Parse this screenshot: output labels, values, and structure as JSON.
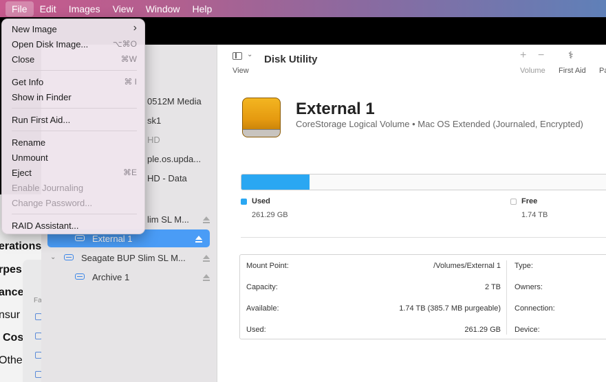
{
  "menubar": {
    "items": [
      "File",
      "Edit",
      "Images",
      "View",
      "Window",
      "Help"
    ],
    "active": "File"
  },
  "file_menu": {
    "items": [
      {
        "label": "New Image",
        "shortcut": "›",
        "enabled": true
      },
      {
        "label": "Open Disk Image...",
        "shortcut": "⌥⌘O",
        "enabled": true
      },
      {
        "label": "Close",
        "shortcut": "⌘W",
        "enabled": true
      },
      {
        "label": "Get Info",
        "shortcut": "⌘ I",
        "enabled": true
      },
      {
        "label": "Show in Finder",
        "shortcut": "",
        "enabled": true
      },
      {
        "label": "Run First Aid...",
        "shortcut": "",
        "enabled": true
      },
      {
        "label": "Rename",
        "shortcut": "",
        "enabled": true
      },
      {
        "label": "Unmount",
        "shortcut": "",
        "enabled": true
      },
      {
        "label": "Eject",
        "shortcut": "⌘E",
        "enabled": true
      },
      {
        "label": "Enable Journaling",
        "shortcut": "",
        "enabled": false
      },
      {
        "label": "Change Password...",
        "shortcut": "",
        "enabled": false
      },
      {
        "label": "RAID Assistant...",
        "shortcut": "",
        "enabled": true
      }
    ]
  },
  "background_window": {
    "labels": [
      "erations",
      "rpes",
      "ance",
      "nsur",
      "Cos",
      "Othe",
      "Fa"
    ]
  },
  "sidebar": {
    "partial_items": [
      "0512M Media",
      "sk1",
      "HD",
      "ple.os.upda...",
      "HD - Data",
      "lim SL M..."
    ],
    "selected": "External 1",
    "disk2": "Seagate BUP Slim SL M...",
    "archive": "Archive 1"
  },
  "toolbar": {
    "title": "Disk Utility",
    "view_label": "View",
    "volume_label": "Volume",
    "first_aid_label": "First Aid",
    "partition_label": "Pa"
  },
  "volume": {
    "name": "External 1",
    "description": "CoreStorage Logical Volume • Mac OS Extended (Journaled, Encrypted)",
    "used_label": "Used",
    "used_value": "261.29 GB",
    "free_label": "Free",
    "free_value": "1.74 TB",
    "used_fraction": 0.184
  },
  "info": {
    "left": [
      {
        "key": "Mount Point:",
        "value": "/Volumes/External 1"
      },
      {
        "key": "Capacity:",
        "value": "2 TB"
      },
      {
        "key": "Available:",
        "value": "1.74 TB (385.7 MB purgeable)"
      },
      {
        "key": "Used:",
        "value": "261.29 GB"
      }
    ],
    "right": [
      "Type:",
      "Owners:",
      "Connection:",
      "Device:"
    ]
  },
  "colors": {
    "accent": "#4a9cf6",
    "used_bar": "#2aa7f2",
    "drive": "#e59a10"
  }
}
